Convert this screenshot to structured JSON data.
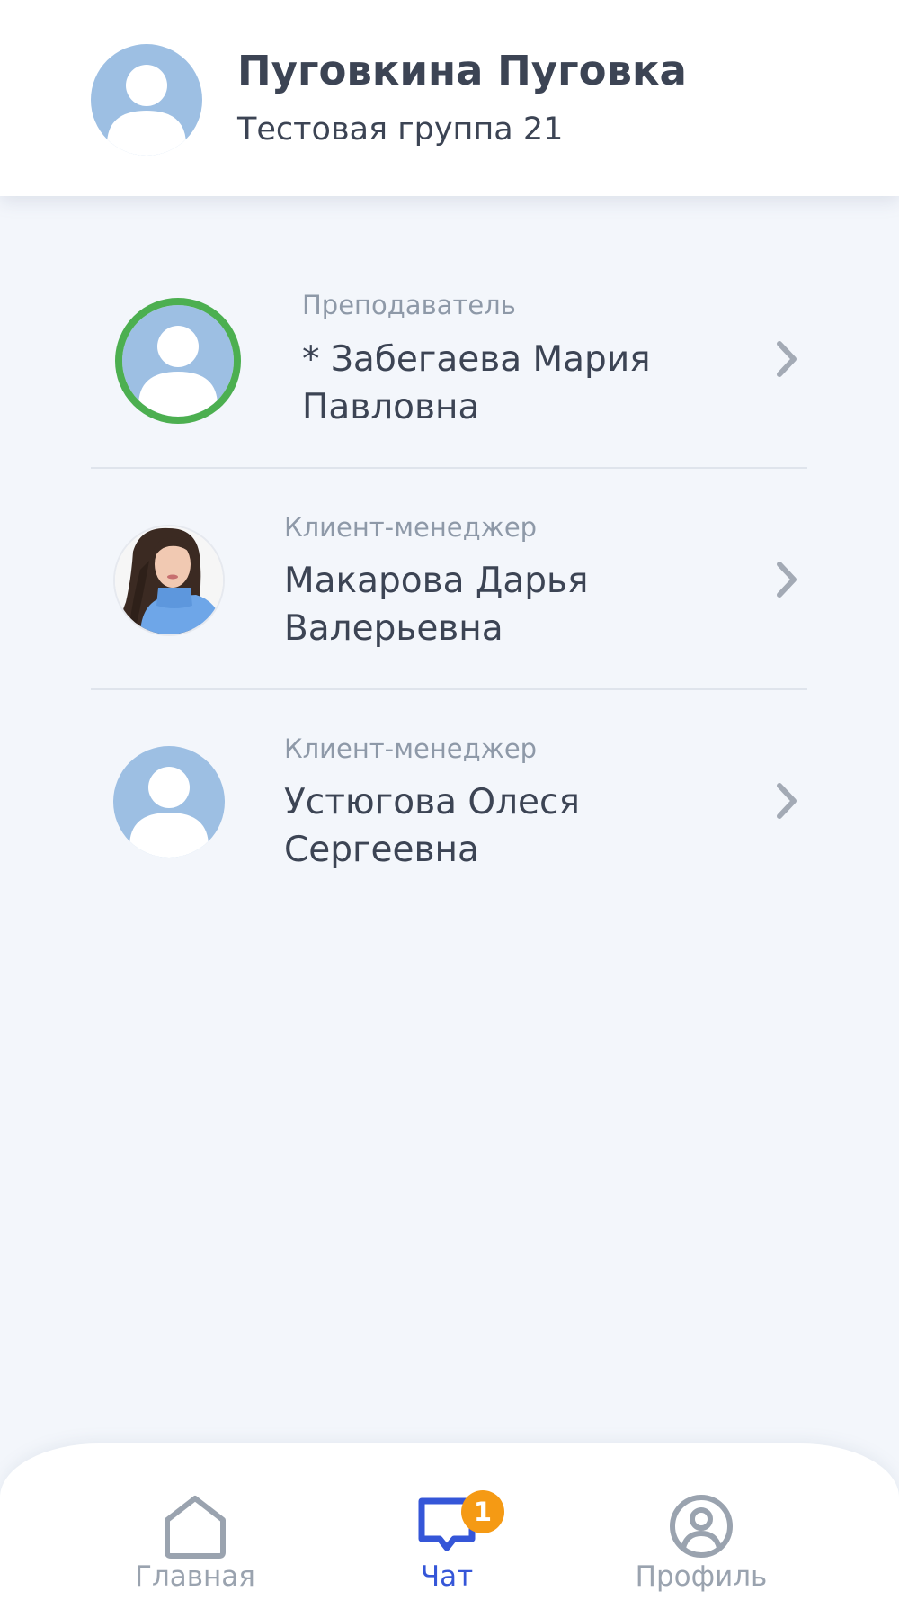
{
  "header": {
    "user_name": "Пуговкина Пуговка",
    "group": "Тестовая группа 21"
  },
  "contacts": [
    {
      "role": "Преподаватель",
      "name_line1": "* Забегаева Мария",
      "name_line2": "Павловна",
      "avatar": "default-user-avatar",
      "online_ring_color": "#4caf50"
    },
    {
      "role": "Клиент-менеджер",
      "name_line1": "Макарова Дарья",
      "name_line2": "Валерьевна",
      "avatar": "photo-avatar"
    },
    {
      "role": "Клиент-менеджер",
      "name_line1": "Устюгова Олеся",
      "name_line2": "Сергеевна",
      "avatar": "default-user-avatar"
    }
  ],
  "tabbar": {
    "tabs": [
      {
        "label": "Главная",
        "icon": "home-icon",
        "active": false
      },
      {
        "label": "Чат",
        "icon": "chat-icon",
        "active": true,
        "badge": "1"
      },
      {
        "label": "Профиль",
        "icon": "profile-icon",
        "active": false
      }
    ]
  },
  "colors": {
    "background": "#f3f6fb",
    "text_primary": "#3c4454",
    "text_secondary": "#8e99a8",
    "accent": "#3556d8",
    "avatar_bg": "#9dbfe3",
    "badge": "#f59a14",
    "online": "#4caf50"
  }
}
